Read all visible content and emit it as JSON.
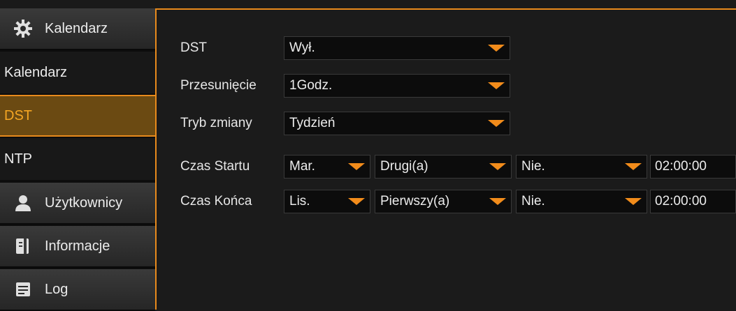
{
  "sidebar": {
    "items": [
      {
        "label": "Kalendarz",
        "icon": "gear-icon"
      },
      {
        "label": "Kalendarz"
      },
      {
        "label": "DST"
      },
      {
        "label": "NTP"
      },
      {
        "label": "Użytkownicy",
        "icon": "user-icon"
      },
      {
        "label": "Informacje",
        "icon": "info-icon"
      },
      {
        "label": "Log",
        "icon": "log-icon"
      }
    ],
    "active": "DST"
  },
  "dst": {
    "dst_label": "DST",
    "dst_value": "Wył.",
    "offset_label": "Przesunięcie",
    "offset_value": "1Godz.",
    "mode_label": "Tryb zmiany",
    "mode_value": "Tydzień"
  },
  "start": {
    "label": "Czas Startu",
    "month": "Mar.",
    "week": "Drugi(a)",
    "day": "Nie.",
    "time": "02:00:00"
  },
  "end": {
    "label": "Czas Końca",
    "month": "Lis.",
    "week": "Pierwszy(a)",
    "day": "Nie.",
    "time": "02:00:00"
  },
  "colors": {
    "accent": "#e88a1c",
    "active_bg": "#6b4a12",
    "active_text": "#f5a623"
  }
}
